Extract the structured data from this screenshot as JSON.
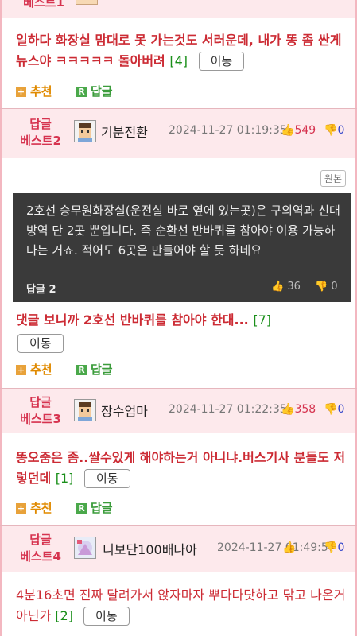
{
  "posts": [
    {
      "badge_line1": "",
      "badge_line2": "베스트1",
      "comment": "일하다 화장실 맘대로 못 가는것도 서러운데, 내가 똥 좀 싼게 뉴스야 ㅋㅋㅋㅋㅋ 돌아버려",
      "count": "[4]",
      "move": "이동",
      "recommend": "추천",
      "reply": "답글"
    },
    {
      "badge_line1": "답글",
      "badge_line2": "베스트2",
      "nickname": "기분전환",
      "datetime": "2024-11-27 01:19:35",
      "likes": "549",
      "dislikes": "0",
      "original_label": "원본",
      "quoted_text": "2호선 승무원화장실(운전실 바로 옆에 있는곳)은 구의역과 신대방역 단 2곳 뿐입니다. 즉 순환선 반바퀴를 참아야 이용 가능하다는 거죠. 적어도 6곳은 만들어야 할 듯 하네요",
      "quoted_reply_label": "답글 2",
      "quoted_likes": "36",
      "quoted_dislikes": "0",
      "comment": "댓글 보니까 2호선 반바퀴를 참아야 한대...",
      "count": "[7]",
      "move": "이동",
      "recommend": "추천",
      "reply": "답글"
    },
    {
      "badge_line1": "답글",
      "badge_line2": "베스트3",
      "nickname": "장수엄마",
      "datetime": "2024-11-27 01:22:35",
      "likes": "358",
      "dislikes": "0",
      "comment": "똥오줌은 좀..쌀수있게 해야하는거 아니냐.버스기사 분들도 저렇던데",
      "count": "[1]",
      "move": "이동",
      "recommend": "추천",
      "reply": "답글"
    },
    {
      "badge_line1": "답글",
      "badge_line2": "베스트4",
      "nickname": "니보단100배나아",
      "datetime": "2024-11-27 01:49:5",
      "likes": "",
      "dislikes": "0",
      "comment": "4분16초면 진짜 달려가서 앉자마자 뿌다다닷하고 닦고 나온거 아닌가",
      "count": "[2]",
      "move": "이동"
    }
  ],
  "colors": {
    "accent": "#d6334f",
    "comment": "#cc2b34",
    "count": "#1a8f1a",
    "header_bg": "#fde9ec",
    "quote_bg": "#3a3a3a"
  }
}
